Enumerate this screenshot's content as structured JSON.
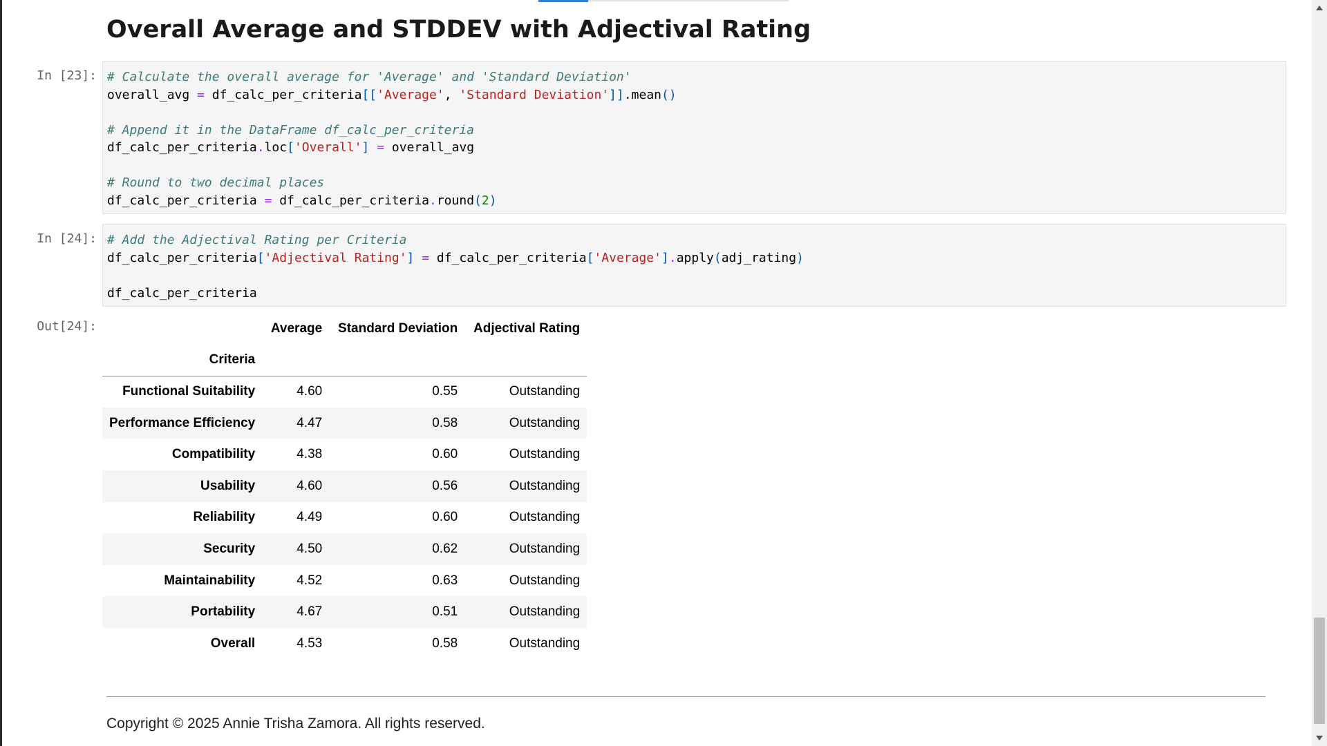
{
  "page": {
    "title": "Overall Average and STDDEV with Adjectival Rating",
    "footer": "Copyright © 2025 Annie Trisha Zamora. All rights reserved."
  },
  "cells": [
    {
      "prompt": "In [23]:",
      "lines": [
        [
          {
            "t": "# Calculate the overall average for 'Average' and 'Standard Deviation'",
            "c": "cm"
          }
        ],
        [
          {
            "t": "overall_avg "
          },
          {
            "t": "=",
            "c": "op"
          },
          {
            "t": " df_calc_per_criteria"
          },
          {
            "t": "[[",
            "c": "pn"
          },
          {
            "t": "'Average'",
            "c": "st"
          },
          {
            "t": ", "
          },
          {
            "t": "'Standard Deviation'",
            "c": "st"
          },
          {
            "t": "]]",
            "c": "pn"
          },
          {
            "t": "."
          },
          {
            "t": "mean"
          },
          {
            "t": "()",
            "c": "pn"
          }
        ],
        [],
        [
          {
            "t": "# Append it in the DataFrame df_calc_per_criteria",
            "c": "cm"
          }
        ],
        [
          {
            "t": "df_calc_per_criteria"
          },
          {
            "t": ".",
            "c": "op"
          },
          {
            "t": "loc"
          },
          {
            "t": "[",
            "c": "pn"
          },
          {
            "t": "'Overall'",
            "c": "st"
          },
          {
            "t": "]",
            "c": "pn"
          },
          {
            "t": " "
          },
          {
            "t": "=",
            "c": "op"
          },
          {
            "t": " overall_avg"
          }
        ],
        [],
        [
          {
            "t": "# Round to two decimal places",
            "c": "cm"
          }
        ],
        [
          {
            "t": "df_calc_per_criteria "
          },
          {
            "t": "=",
            "c": "op"
          },
          {
            "t": " df_calc_per_criteria"
          },
          {
            "t": ".",
            "c": "op"
          },
          {
            "t": "round"
          },
          {
            "t": "(",
            "c": "pn"
          },
          {
            "t": "2",
            "c": "nm"
          },
          {
            "t": ")",
            "c": "pn"
          }
        ]
      ]
    },
    {
      "prompt": "In [24]:",
      "lines": [
        [
          {
            "t": "# Add the Adjectival Rating per Criteria",
            "c": "cm"
          }
        ],
        [
          {
            "t": "df_calc_per_criteria"
          },
          {
            "t": "[",
            "c": "pn"
          },
          {
            "t": "'Adjectival Rating'",
            "c": "st"
          },
          {
            "t": "]",
            "c": "pn"
          },
          {
            "t": " "
          },
          {
            "t": "=",
            "c": "op"
          },
          {
            "t": " df_calc_per_criteria"
          },
          {
            "t": "[",
            "c": "pn"
          },
          {
            "t": "'Average'",
            "c": "st"
          },
          {
            "t": "]",
            "c": "pn"
          },
          {
            "t": ".",
            "c": "op"
          },
          {
            "t": "apply"
          },
          {
            "t": "(",
            "c": "pn"
          },
          {
            "t": "adj_rating"
          },
          {
            "t": ")",
            "c": "pn"
          }
        ],
        [],
        [
          {
            "t": "df_calc_per_criteria"
          }
        ]
      ]
    }
  ],
  "output": {
    "prompt": "Out[24]:",
    "columns": [
      "Average",
      "Standard Deviation",
      "Adjectival Rating"
    ],
    "index_name": "Criteria",
    "rows": [
      {
        "criteria": "Functional Suitability",
        "average": "4.60",
        "std": "0.55",
        "rating": "Outstanding"
      },
      {
        "criteria": "Performance Efficiency",
        "average": "4.47",
        "std": "0.58",
        "rating": "Outstanding"
      },
      {
        "criteria": "Compatibility",
        "average": "4.38",
        "std": "0.60",
        "rating": "Outstanding"
      },
      {
        "criteria": "Usability",
        "average": "4.60",
        "std": "0.56",
        "rating": "Outstanding"
      },
      {
        "criteria": "Reliability",
        "average": "4.49",
        "std": "0.60",
        "rating": "Outstanding"
      },
      {
        "criteria": "Security",
        "average": "4.50",
        "std": "0.62",
        "rating": "Outstanding"
      },
      {
        "criteria": "Maintainability",
        "average": "4.52",
        "std": "0.63",
        "rating": "Outstanding"
      },
      {
        "criteria": "Portability",
        "average": "4.67",
        "std": "0.51",
        "rating": "Outstanding"
      },
      {
        "criteria": "Overall",
        "average": "4.53",
        "std": "0.58",
        "rating": "Outstanding"
      }
    ]
  },
  "icons": {
    "scroll_up": "chevron-up-icon",
    "scroll_down": "chevron-down-icon"
  }
}
